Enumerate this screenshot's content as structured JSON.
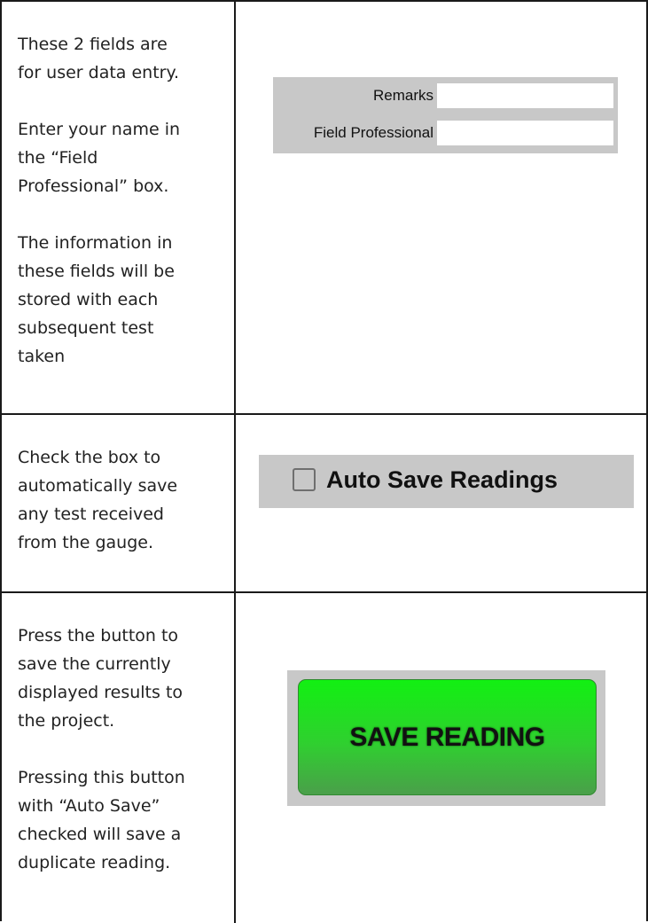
{
  "rows": [
    {
      "paragraphs": [
        "These 2 fields are\nfor user data entry.",
        "Enter your name in\nthe “Field\nProfessional” box.",
        "The information in\nthese fields will be\nstored with each\nsubsequent test\ntaken"
      ]
    },
    {
      "paragraphs": [
        "Check the box to\nautomatically save\nany test received\nfrom the gauge."
      ]
    },
    {
      "paragraphs": [
        "Press the button to\nsave the currently\ndisplayed results to\nthe project.",
        "Pressing this button\nwith “Auto Save”\nchecked will save a\nduplicate reading."
      ]
    }
  ],
  "fields": {
    "remarks_label": "Remarks",
    "remarks_value": "",
    "professional_label": "Field Professional",
    "professional_value": ""
  },
  "autosave": {
    "label": "Auto Save Readings",
    "checked": false
  },
  "save_button": {
    "label": "SAVE READING",
    "color": "#12f012"
  },
  "colors": {
    "panel_gray": "#c8c8c8",
    "border": "#1a1a1a"
  }
}
